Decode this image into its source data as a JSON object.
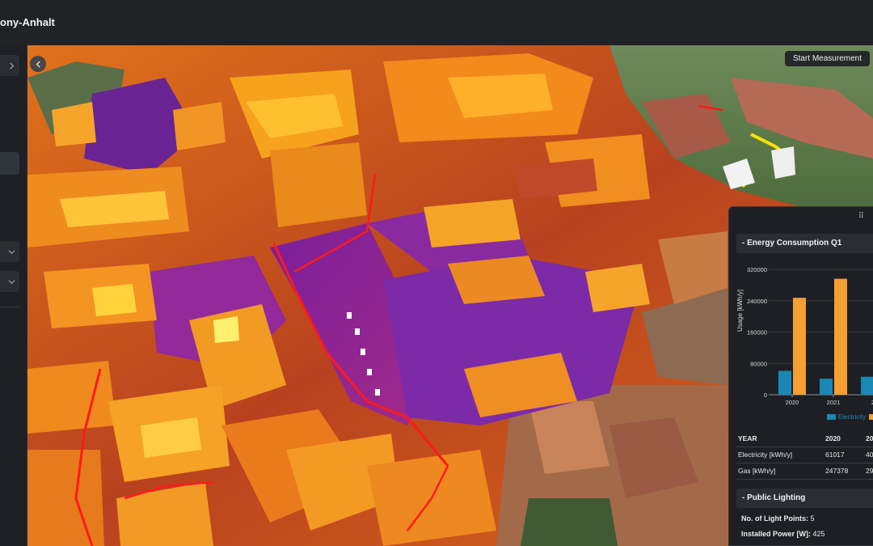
{
  "app": {
    "title": "ony-Anhalt"
  },
  "map": {
    "start_measurement_label": "Start Measurement"
  },
  "panel": {
    "energy": {
      "title": "- Energy Consumption Q1",
      "table": {
        "header": [
          "YEAR",
          "2020",
          "20"
        ],
        "rows": [
          {
            "label": "Electricity [kWh/y]",
            "v2020": "61017",
            "v2021": "40"
          },
          {
            "label": "Gas [kWh/y]",
            "v2020": "247378",
            "v2021": "29"
          }
        ]
      }
    },
    "lighting": {
      "title": "- Public Lighting",
      "light_points_label": "No. of Light Points:",
      "light_points_value": "5",
      "installed_power_label": "Installed Power [W]:",
      "installed_power_value": "425"
    }
  },
  "colors": {
    "electricity": "#1b87b5",
    "gas": "#f5a030",
    "accent_red": "#ff1a1a"
  },
  "chart_data": {
    "type": "bar",
    "categories": [
      "2020",
      "2021",
      "20"
    ],
    "series": [
      {
        "name": "Electricity",
        "values": [
          61017,
          41000,
          46000
        ]
      },
      {
        "name": "",
        "values": [
          247378,
          296000,
          null
        ]
      }
    ],
    "ylabel": "Usage [kWh/y]",
    "ylim": [
      0,
      320000
    ],
    "yticks": [
      "320000",
      "240000",
      "160000",
      "80000",
      "0"
    ],
    "legend": "bottom"
  }
}
